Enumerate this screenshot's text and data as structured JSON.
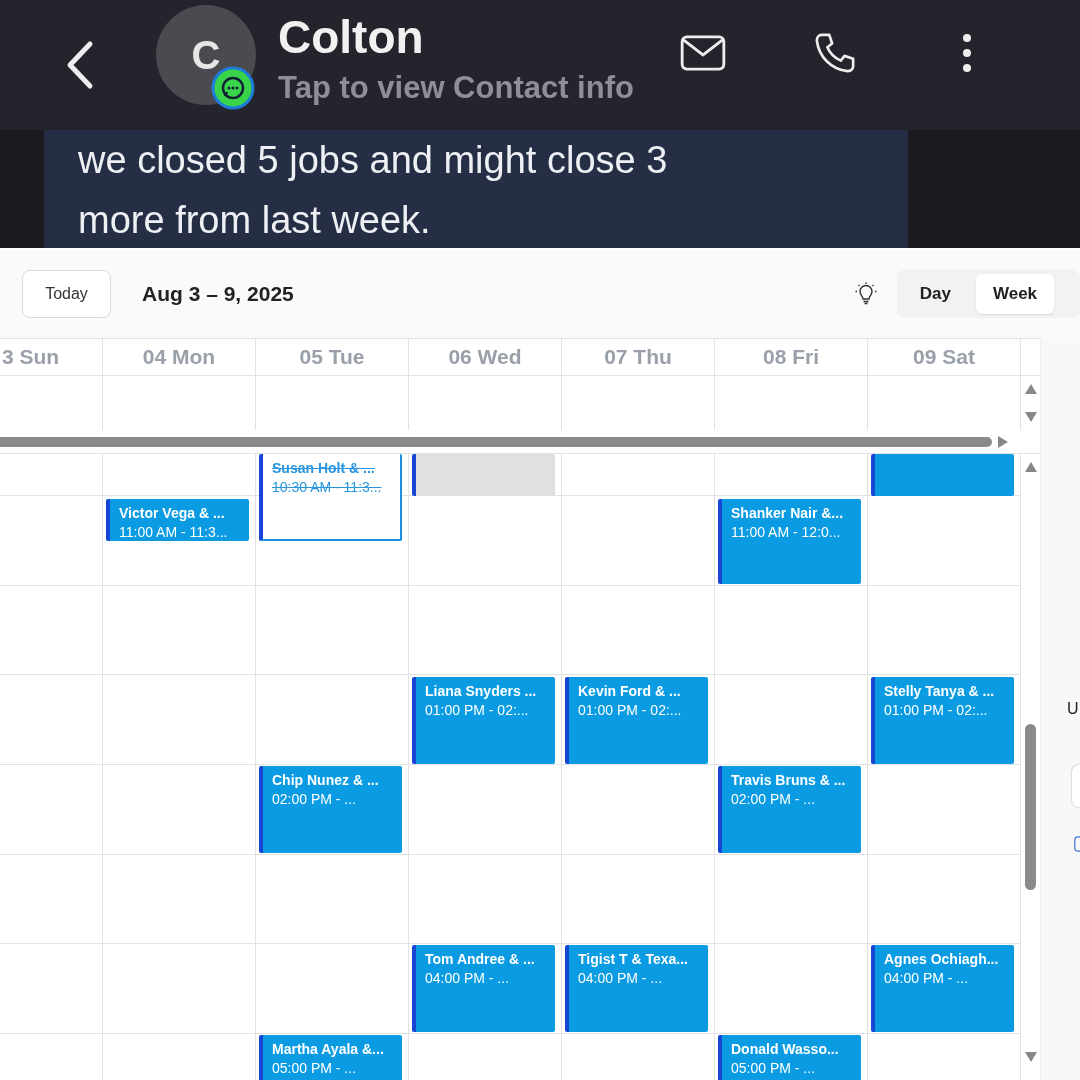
{
  "contact_header": {
    "name": "Colton",
    "subtitle": "Tap to view Contact info",
    "avatar_initial": "C"
  },
  "message": {
    "text": "we closed 5 jobs and might close 3 more from last week."
  },
  "calendar": {
    "today_button": "Today",
    "date_range": "Aug 3 – 9, 2025",
    "views": [
      {
        "label": "Day",
        "selected": false
      },
      {
        "label": "Week",
        "selected": true
      }
    ],
    "days": [
      "3 Sun",
      "04 Mon",
      "05 Tue",
      "06 Wed",
      "07 Thu",
      "08 Fri",
      "09 Sat"
    ],
    "events": [
      {
        "kind": "cancelled",
        "title": "Susan Holt & ...",
        "time": "10:30 AM - 11:3..."
      },
      {
        "kind": "blocked"
      },
      {
        "kind": "appointment"
      },
      {
        "kind": "appointment",
        "title": "Victor Vega & ...",
        "time": "11:00 AM - 11:3..."
      },
      {
        "kind": "appointment",
        "title": "Shanker Nair &...",
        "time": "11:00 AM - 12:0..."
      },
      {
        "kind": "appointment",
        "title": "Liana Snyders ...",
        "time": "01:00 PM - 02:..."
      },
      {
        "kind": "appointment",
        "title": "Kevin Ford & ...",
        "time": "01:00 PM - 02:..."
      },
      {
        "kind": "appointment",
        "title": "Stelly Tanya & ...",
        "time": "01:00 PM - 02:..."
      },
      {
        "kind": "appointment",
        "title": "Chip Nunez & ...",
        "time": "02:00 PM - ..."
      },
      {
        "kind": "appointment",
        "title": "Travis Bruns & ...",
        "time": "02:00 PM - ..."
      },
      {
        "kind": "appointment",
        "title": "Tom Andree & ...",
        "time": "04:00 PM - ..."
      },
      {
        "kind": "appointment",
        "title": "Tigist T & Texa...",
        "time": "04:00 PM - ..."
      },
      {
        "kind": "appointment",
        "title": "Agnes Ochiagh...",
        "time": "04:00 PM - ..."
      },
      {
        "kind": "appointment",
        "title": "Martha Ayala &...",
        "time": "05:00 PM - ..."
      },
      {
        "kind": "appointment",
        "title": "Donald Wasso...",
        "time": "05:00 PM - ..."
      }
    ]
  },
  "side_panel": {
    "text": "U"
  }
}
